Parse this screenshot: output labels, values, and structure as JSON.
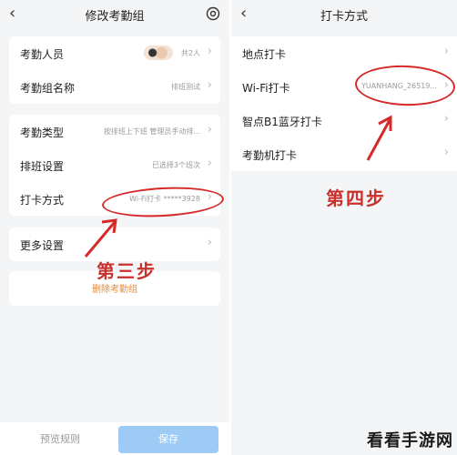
{
  "left": {
    "title": "修改考勤组",
    "back_icon": "chevron-left-icon",
    "settings_icon": "settings-icon",
    "rows": [
      {
        "label": "考勤人员",
        "value": "共2人"
      },
      {
        "label": "考勤组名称",
        "value": "排班测试"
      },
      {
        "label": "考勤类型",
        "value": "按排班上下班  管理员手动排..."
      },
      {
        "label": "排班设置",
        "value": "已选择3个班次"
      },
      {
        "label": "打卡方式",
        "value": "Wi-Fi打卡 *****3928"
      },
      {
        "label": "更多设置",
        "value": ""
      }
    ],
    "delete_label": "删除考勤组",
    "preview_label": "预览规则",
    "save_label": "保存"
  },
  "right": {
    "title": "打卡方式",
    "back_icon": "chevron-left-icon",
    "rows": [
      {
        "label": "地点打卡",
        "value": ""
      },
      {
        "label": "Wi-Fi打卡",
        "value": "YUANHANG_26519..."
      },
      {
        "label": "智点B1蓝牙打卡",
        "value": ""
      },
      {
        "label": "考勤机打卡",
        "value": ""
      }
    ]
  },
  "annotations": {
    "step3": "第三步",
    "step4": "第四步",
    "color": "#d52a2a"
  },
  "watermark": "看看手游网",
  "colors": {
    "background": "#f4f5f7",
    "save_button": "#9ecbf5",
    "delete_text": "#e38a3c"
  }
}
